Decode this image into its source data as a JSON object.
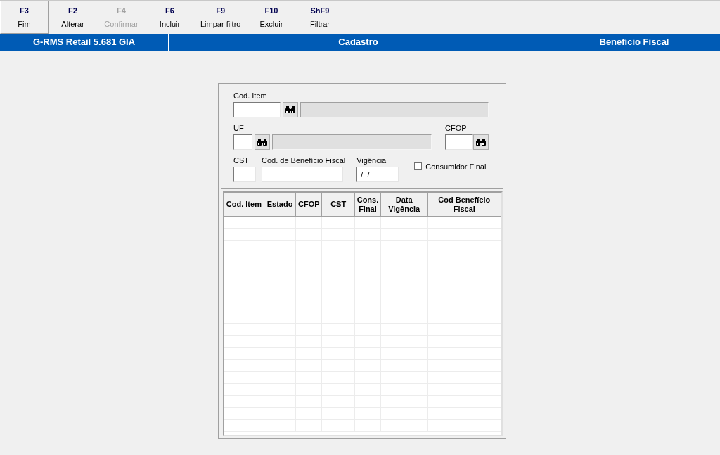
{
  "toolbar": [
    {
      "key": "F3",
      "label": "Fim",
      "selected": true,
      "disabled": false
    },
    {
      "key": "F2",
      "label": "Alterar",
      "selected": false,
      "disabled": false
    },
    {
      "key": "F4",
      "label": "Confirmar",
      "selected": false,
      "disabled": true
    },
    {
      "key": "F6",
      "label": "Incluir",
      "selected": false,
      "disabled": false
    },
    {
      "key": "F9",
      "label": "Limpar filtro",
      "selected": false,
      "disabled": false
    },
    {
      "key": "F10",
      "label": "Excluir",
      "selected": false,
      "disabled": false
    },
    {
      "key": "ShF9",
      "label": "Filtrar",
      "selected": false,
      "disabled": false
    }
  ],
  "title_bar": [
    "G-RMS Retail 5.681 GIA",
    "Cadastro",
    "Benefício Fiscal"
  ],
  "form": {
    "cod_item": {
      "label": "Cod. Item"
    },
    "uf": {
      "label": "UF"
    },
    "cfop": {
      "label": "CFOP"
    },
    "cst": {
      "label": "CST"
    },
    "cod_beneficio": {
      "label": "Cod. de Benefício Fiscal"
    },
    "vigencia": {
      "label": "Vigência",
      "value": " /  /"
    },
    "consumidor_final": {
      "label": "Consumidor Final",
      "checked": false
    }
  },
  "table": {
    "columns": [
      "Cod. Item",
      "Estado",
      "CFOP",
      "CST",
      "Cons. Final",
      "Data Vigência",
      "Cod Benefício Fiscal"
    ]
  }
}
